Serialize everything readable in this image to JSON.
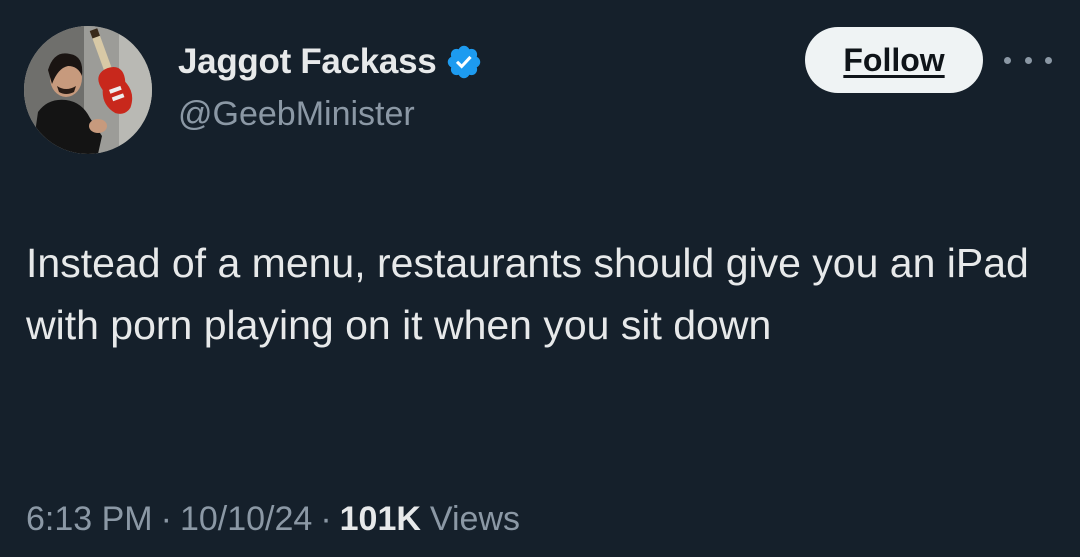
{
  "author": {
    "display_name": "Jaggot Fackass",
    "handle": "@GeebMinister",
    "verified": true,
    "verified_color": "#1d9bf0"
  },
  "actions": {
    "follow_label": "Follow",
    "more_icon": "more-horizontal-icon"
  },
  "tweet": {
    "text": "Instead of a menu, restaurants should give you an iPad with porn playing on it when you sit down"
  },
  "meta": {
    "time": "6:13 PM",
    "separator": "·",
    "date": "10/10/24",
    "views_count": "101K",
    "views_label": "Views"
  },
  "colors": {
    "background": "#15202b",
    "primary_text": "#e7e9ea",
    "secondary_text": "#8b98a5",
    "follow_button_bg": "#eff3f4"
  }
}
